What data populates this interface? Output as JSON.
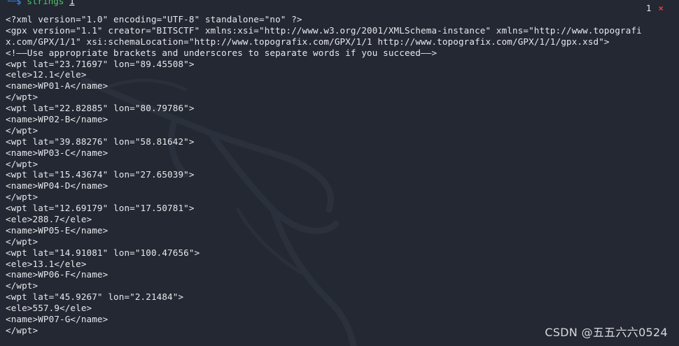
{
  "prompt": {
    "frame": "└─",
    "sign": "$",
    "command": "strings",
    "argument": "1"
  },
  "badge": {
    "count": "1",
    "close_glyph": "×"
  },
  "output_lines": [
    "<?xml version=\"1.0\" encoding=\"UTF-8\" standalone=\"no\" ?>",
    "<gpx version=\"1.1\" creator=\"BITSCTF\" xmlns:xsi=\"http://www.w3.org/2001/XMLSchema-instance\" xmlns=\"http://www.topografi",
    "x.com/GPX/1/1\" xsi:schemaLocation=\"http://www.topografix.com/GPX/1/1 http://www.topografix.com/GPX/1/1/gpx.xsd\">",
    "<!——Use appropriate brackets and underscores to separate words if you succeed——>",
    "<wpt lat=\"23.71697\" lon=\"89.45508\">",
    "<ele>12.1</ele>",
    "<name>WP01-A</name>",
    "</wpt>",
    "<wpt lat=\"22.82885\" lon=\"80.79786\">",
    "<name>WP02-B</name>",
    "</wpt>",
    "<wpt lat=\"39.88276\" lon=\"58.81642\">",
    "<name>WP03-C</name>",
    "</wpt>",
    "<wpt lat=\"15.43674\" lon=\"27.65039\">",
    "<name>WP04-D</name>",
    "</wpt>",
    "<wpt lat=\"12.69179\" lon=\"17.50781\">",
    "<ele>288.7</ele>",
    "<name>WP05-E</name>",
    "</wpt>",
    "<wpt lat=\"14.91081\" lon=\"100.47656\">",
    "<ele>13.1</ele>",
    "<name>WP06-F</name>",
    "</wpt>",
    "<wpt lat=\"45.9267\" lon=\"2.21484\">",
    "<ele>557.9</ele>",
    "<name>WP07-G</name>",
    "</wpt>"
  ],
  "watermark": "CSDN @五五六六0524",
  "colors": {
    "background": "#232832",
    "text": "#e6e8ec",
    "prompt_frame": "#2f7fd8",
    "command": "#4fc46a",
    "close": "#e03b3b"
  },
  "icons": {
    "close": "close-icon",
    "background_logo": "kali-dragon-icon"
  }
}
